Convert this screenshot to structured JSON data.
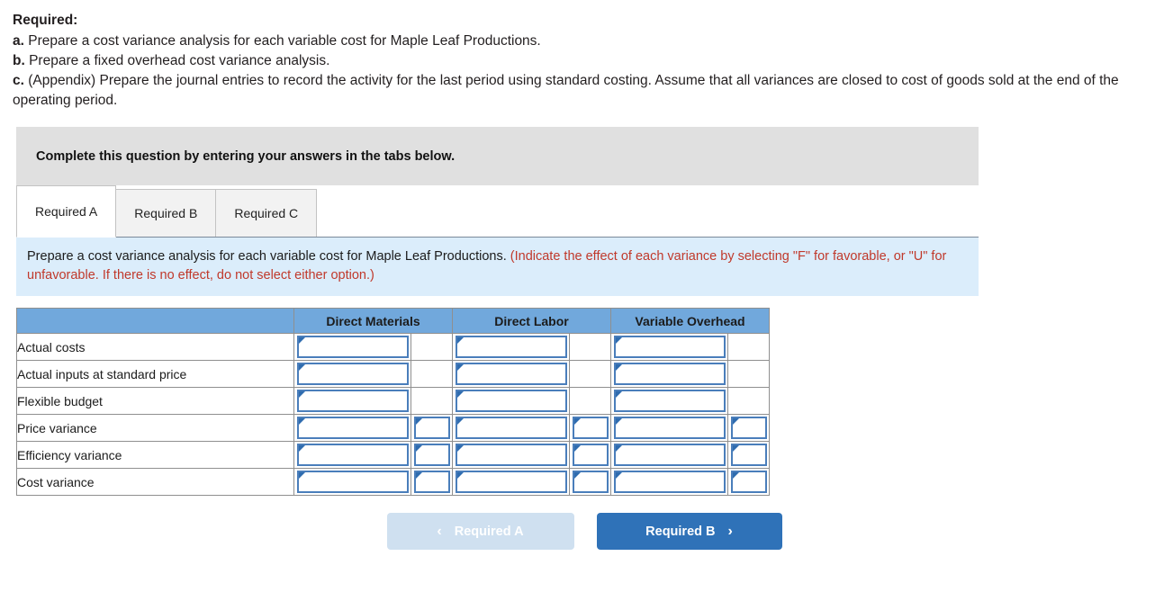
{
  "required": {
    "heading": "Required:",
    "items": [
      {
        "letter": "a.",
        "text": "Prepare a cost variance analysis for each variable cost for Maple Leaf Productions."
      },
      {
        "letter": "b.",
        "text": "Prepare a fixed overhead cost variance analysis."
      },
      {
        "letter": "c.",
        "text": "(Appendix) Prepare the journal entries to record the activity for the last period using standard costing. Assume that all variances are closed to cost of goods sold at the end of the operating period."
      }
    ]
  },
  "banner": {
    "text": "Complete this question by entering your answers in the tabs below."
  },
  "tabs": [
    {
      "label": "Required A",
      "active": true
    },
    {
      "label": "Required B",
      "active": false
    },
    {
      "label": "Required C",
      "active": false
    }
  ],
  "instruction": {
    "main": "Prepare a cost variance analysis for each variable cost for Maple Leaf Productions.",
    "note": "(Indicate the effect of each variance by selecting \"F\" for favorable, or \"U\" for unfavorable. If there is no effect, do not select either option.)"
  },
  "table": {
    "corner_label": "",
    "columns": [
      "Direct Materials",
      "Direct Labor",
      "Variable Overhead"
    ],
    "rows": [
      {
        "label": "Actual costs",
        "has_fu": false
      },
      {
        "label": "Actual inputs at standard price",
        "has_fu": false
      },
      {
        "label": "Flexible budget",
        "has_fu": false
      },
      {
        "label": "Price variance",
        "has_fu": true
      },
      {
        "label": "Efficiency variance",
        "has_fu": true
      },
      {
        "label": "Cost variance",
        "has_fu": true
      }
    ]
  },
  "nav": {
    "prev_label": "Required A",
    "next_label": "Required B",
    "prev_chevron": "‹",
    "next_chevron": "›"
  },
  "colors": {
    "header_blue": "#71a8dc",
    "panel_blue": "#dbedfb",
    "banner_gray": "#e0e0e0",
    "red_note": "#c0392b",
    "button_blue": "#2f72b8",
    "button_disabled": "#cfe0f0",
    "input_border": "#4a7ebb"
  }
}
